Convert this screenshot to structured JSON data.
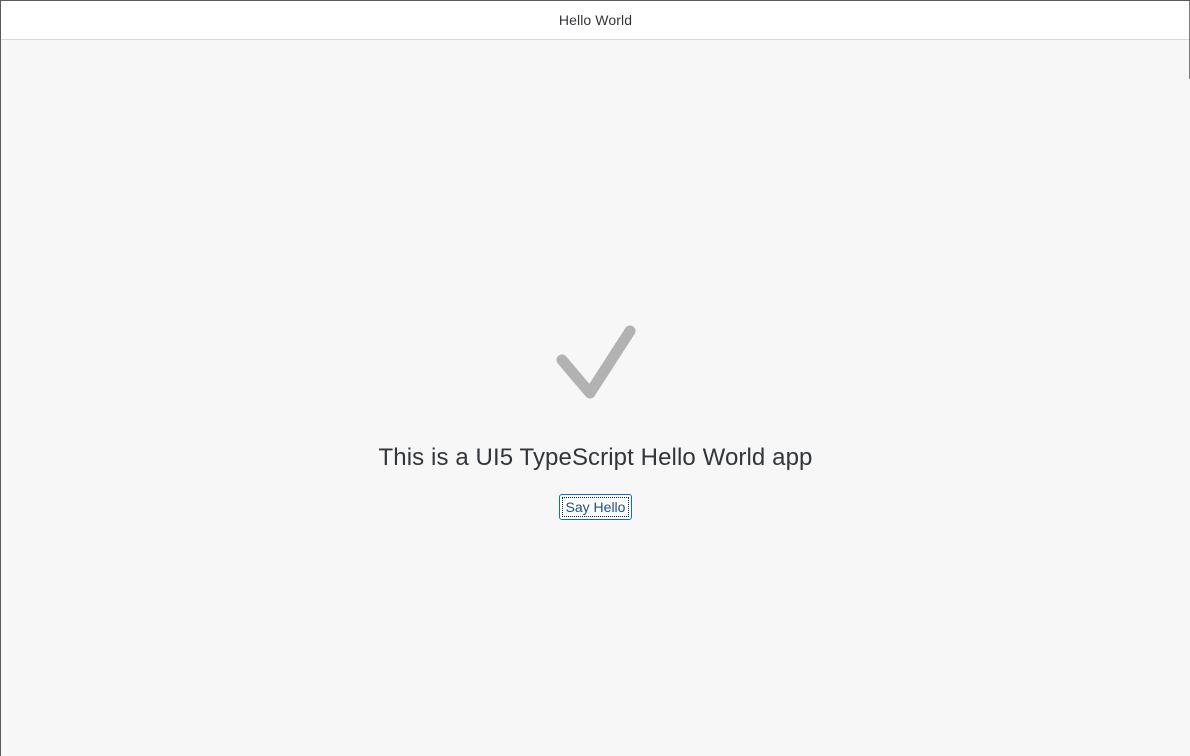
{
  "header": {
    "title": "Hello World"
  },
  "main": {
    "icon": "checkmark-icon",
    "icon_color": "#b2b2b2",
    "headline": "This is a UI5 TypeScript Hello World app",
    "button_label": "Say Hello"
  },
  "colors": {
    "background": "#f7f7f7",
    "header_background": "#ffffff",
    "text": "#32363a",
    "accent": "#0a6ed1"
  }
}
